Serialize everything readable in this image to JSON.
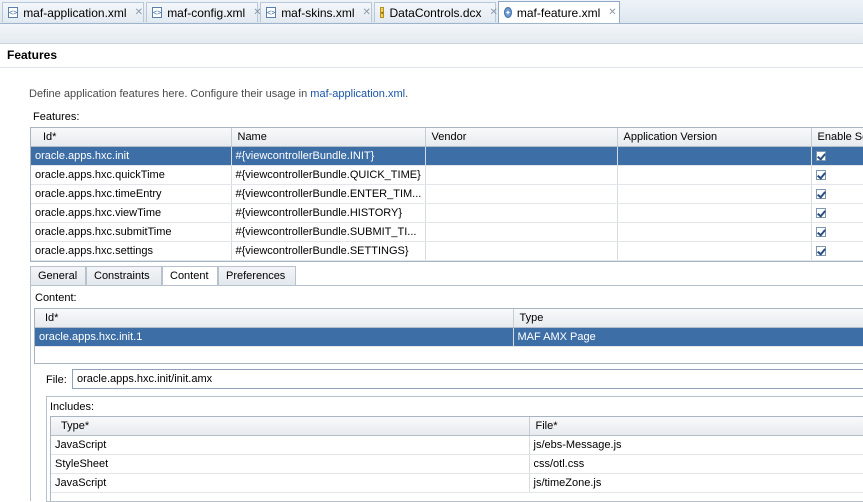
{
  "editor_tabs": [
    {
      "label": "maf-application.xml",
      "icon": "xml-file-icon"
    },
    {
      "label": "maf-config.xml",
      "icon": "xml-file-icon"
    },
    {
      "label": "maf-skins.xml",
      "icon": "xml-file-icon"
    },
    {
      "label": "DataControls.dcx",
      "icon": "dcx-file-icon"
    },
    {
      "label": "maf-feature.xml",
      "icon": "feature-file-icon",
      "active": true
    }
  ],
  "page": {
    "title": "Features",
    "description_prefix": "Define application features here. Configure their usage in ",
    "description_link": "maf-application.xml",
    "description_suffix": "."
  },
  "features": {
    "label": "Features:",
    "columns": [
      "Id*",
      "Name",
      "Vendor",
      "Application Version",
      "Enable Se"
    ],
    "rows": [
      {
        "id": "oracle.apps.hxc.init",
        "name": "#{viewcontrollerBundle.INIT}",
        "vendor": "",
        "version": "",
        "enabled": true,
        "selected": true
      },
      {
        "id": "oracle.apps.hxc.quickTime",
        "name": "#{viewcontrollerBundle.QUICK_TIME}",
        "vendor": "",
        "version": "",
        "enabled": true
      },
      {
        "id": "oracle.apps.hxc.timeEntry",
        "name": "#{viewcontrollerBundle.ENTER_TIM...",
        "vendor": "",
        "version": "",
        "enabled": true
      },
      {
        "id": "oracle.apps.hxc.viewTime",
        "name": "#{viewcontrollerBundle.HISTORY}",
        "vendor": "",
        "version": "",
        "enabled": true
      },
      {
        "id": "oracle.apps.hxc.submitTime",
        "name": "#{viewcontrollerBundle.SUBMIT_TI...",
        "vendor": "",
        "version": "",
        "enabled": true
      },
      {
        "id": "oracle.apps.hxc.settings",
        "name": "#{viewcontrollerBundle.SETTINGS}",
        "vendor": "",
        "version": "",
        "enabled": true
      }
    ]
  },
  "sub_tabs": [
    {
      "label": "General"
    },
    {
      "label": "Constraints"
    },
    {
      "label": "Content",
      "active": true
    },
    {
      "label": "Preferences"
    }
  ],
  "content": {
    "label": "Content:",
    "columns": [
      "Id*",
      "Type"
    ],
    "rows": [
      {
        "id": "oracle.apps.hxc.init.1",
        "type": "MAF AMX Page",
        "selected": true
      }
    ],
    "file_label": "File:",
    "file_value": "oracle.apps.hxc.init/init.amx"
  },
  "includes": {
    "label": "Includes:",
    "columns": [
      "Type*",
      "File*"
    ],
    "rows": [
      {
        "type": "JavaScript",
        "file": "js/ebs-Message.js"
      },
      {
        "type": "StyleSheet",
        "file": "css/otl.css"
      },
      {
        "type": "JavaScript",
        "file": "js/timeZone.js"
      }
    ]
  },
  "colors": {
    "selection": "#3d6ea5",
    "link": "#1a55a8"
  }
}
